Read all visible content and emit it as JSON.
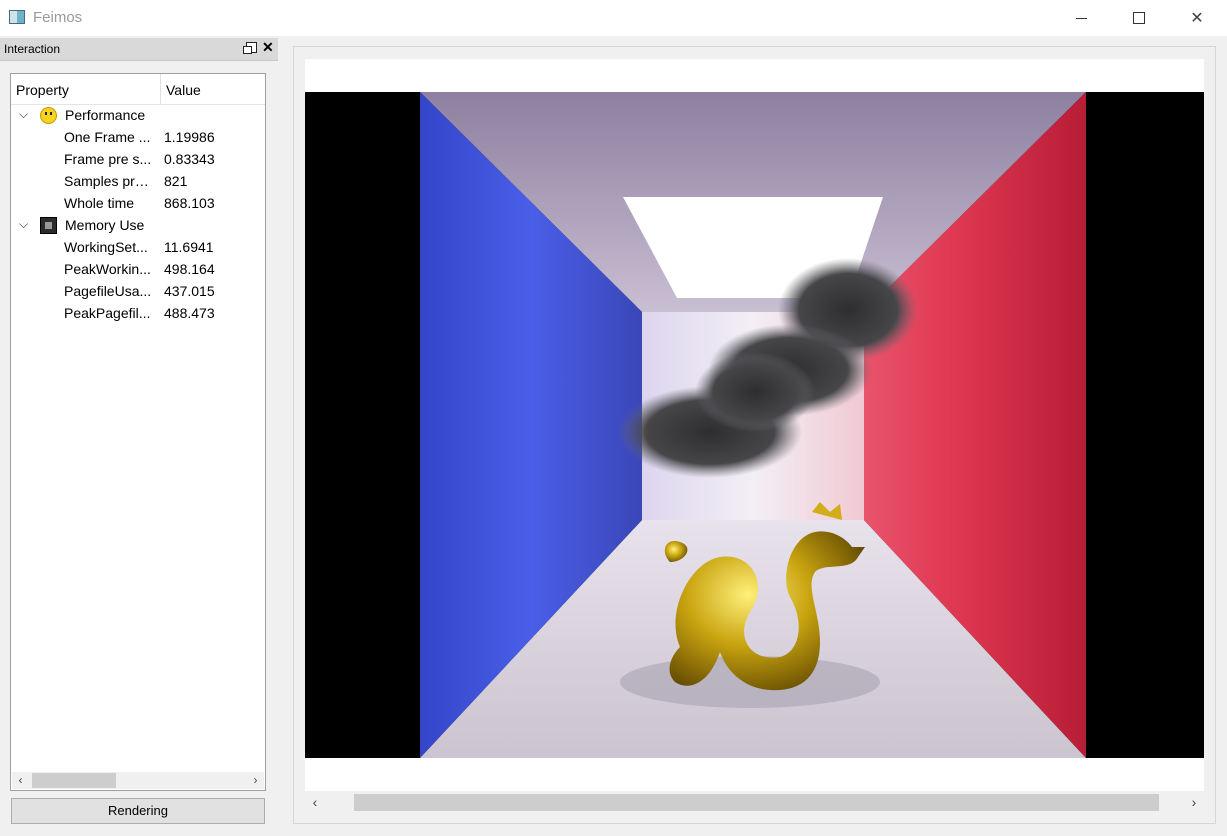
{
  "window": {
    "title": "Feimos",
    "app_icon": "app-window-icon"
  },
  "dock": {
    "title": "Interaction",
    "float_icon": "float-icon",
    "close_icon": "close-icon",
    "columns": {
      "property": "Property",
      "value": "Value"
    },
    "groups": [
      {
        "label": "Performance",
        "icon": "smiley-icon",
        "expander": "chevron-down-icon",
        "items": [
          {
            "label": "One Frame ...",
            "value": "1.19986"
          },
          {
            "label": "Frame pre s...",
            "value": "0.83343"
          },
          {
            "label": "Samples pre...",
            "value": "821"
          },
          {
            "label": "Whole time",
            "value": "868.103"
          }
        ]
      },
      {
        "label": "Memory Use",
        "icon": "memory-chip-icon",
        "expander": "chevron-down-icon",
        "items": [
          {
            "label": "WorkingSet...",
            "value": "11.6941"
          },
          {
            "label": "PeakWorkin...",
            "value": "498.164"
          },
          {
            "label": "PagefileUsa...",
            "value": "437.015"
          },
          {
            "label": "PeakPagefil...",
            "value": "488.473"
          }
        ]
      }
    ],
    "render_button": "Rendering"
  },
  "viewer": {
    "image": "cornell-box-dragon-smoke-render",
    "colors": {
      "left_wall": "#3b4fd8",
      "right_wall": "#d82a4a",
      "dragon": "#c9a410",
      "smoke": "#3a3a3c"
    }
  }
}
